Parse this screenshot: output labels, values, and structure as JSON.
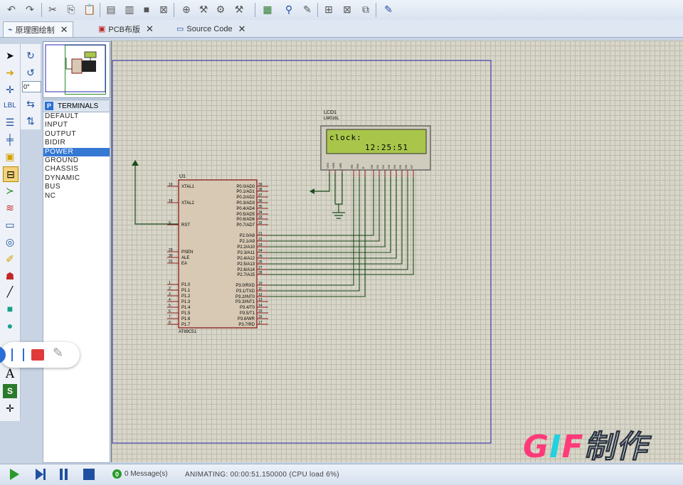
{
  "tabs": [
    {
      "label": "原理图绘制",
      "close": "✕"
    },
    {
      "label": "PCB布版",
      "close": "✕"
    },
    {
      "label": "Source Code",
      "close": "✕"
    }
  ],
  "selector": {
    "mode": "P",
    "header": "TERMINALS",
    "rotation": "0°"
  },
  "terminals": [
    "DEFAULT",
    "INPUT",
    "OUTPUT",
    "BIDIR",
    "POWER",
    "GROUND",
    "CHASSIS",
    "DYNAMIC",
    "BUS",
    "NC"
  ],
  "selected_terminal": "POWER",
  "schematic": {
    "mcu": {
      "ref": "U1",
      "part": "AT89C51",
      "left_pins": [
        [
          "19",
          "XTAL1"
        ],
        [
          "18",
          "XTAL2"
        ],
        [
          "9",
          "RST"
        ],
        [
          "29",
          "PSEN"
        ],
        [
          "30",
          "ALE"
        ],
        [
          "31",
          "EA"
        ],
        [
          "1",
          "P1.0"
        ],
        [
          "2",
          "P1.1"
        ],
        [
          "3",
          "P1.2"
        ],
        [
          "4",
          "P1.3"
        ],
        [
          "5",
          "P1.4"
        ],
        [
          "6",
          "P1.5"
        ],
        [
          "7",
          "P1.6"
        ],
        [
          "8",
          "P1.7"
        ]
      ],
      "right_pins": [
        [
          "39",
          "P0.0/AD0"
        ],
        [
          "38",
          "P0.1/AD1"
        ],
        [
          "37",
          "P0.2/AD2"
        ],
        [
          "36",
          "P0.3/AD3"
        ],
        [
          "35",
          "P0.4/AD4"
        ],
        [
          "34",
          "P0.5/AD5"
        ],
        [
          "33",
          "P0.6/AD6"
        ],
        [
          "32",
          "P0.7/AD7"
        ],
        [
          "21",
          "P2.0/A8"
        ],
        [
          "22",
          "P2.1/A9"
        ],
        [
          "23",
          "P2.2/A10"
        ],
        [
          "24",
          "P2.3/A11"
        ],
        [
          "25",
          "P2.4/A12"
        ],
        [
          "26",
          "P2.5/A13"
        ],
        [
          "27",
          "P2.6/A14"
        ],
        [
          "28",
          "P2.7/A15"
        ],
        [
          "10",
          "P3.0/RXD"
        ],
        [
          "11",
          "P3.1/TXD"
        ],
        [
          "12",
          "P3.2/INT0"
        ],
        [
          "13",
          "P3.3/INT1"
        ],
        [
          "14",
          "P3.4/T0"
        ],
        [
          "15",
          "P3.5/T1"
        ],
        [
          "16",
          "P3.6/WR"
        ],
        [
          "17",
          "P3.7/RD"
        ]
      ]
    },
    "lcd": {
      "ref": "LCD1",
      "part": "LM016L",
      "line1": "clock:",
      "line2": "12:25:51",
      "pins": [
        "VSS",
        "VDD",
        "VEE",
        "RS",
        "RW",
        "E",
        "D0",
        "D1",
        "D2",
        "D3",
        "D4",
        "D5",
        "D6",
        "D7"
      ]
    }
  },
  "status": {
    "messages": "0 Message(s)",
    "message_count": "0",
    "animation": "ANIMATING: 00:00:51.150000 (CPU load 6%)"
  },
  "watermark": {
    "g": "G",
    "i": "I",
    "f": "F",
    "text": "制作"
  },
  "colors": {
    "wire": "#1a4a1a",
    "component_fill": "#d7c9b4",
    "component_border": "#8b1a1a",
    "lcd_screen": "#a9c64a",
    "sheet_border": "#2a2ab0"
  }
}
